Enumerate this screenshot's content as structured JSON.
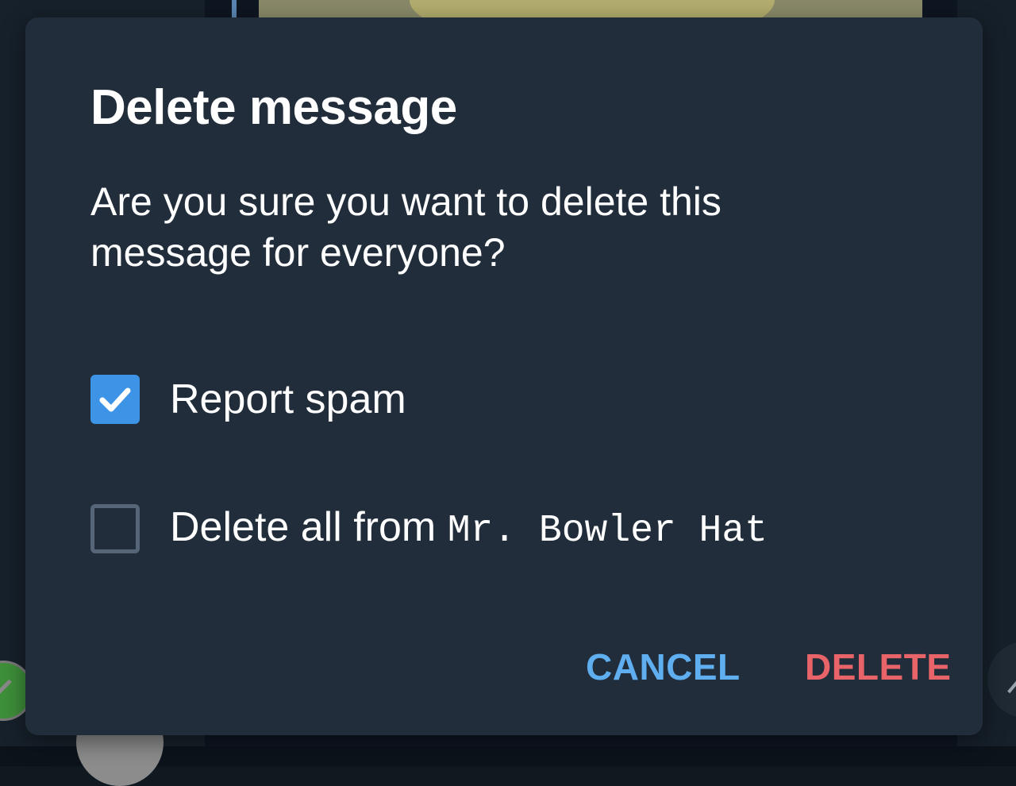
{
  "dialog": {
    "title": "Delete message",
    "body": "Are you sure you want to delete this message for everyone?",
    "options": [
      {
        "label": "Report spam",
        "checked": true
      },
      {
        "label_prefix": "Delete all from ",
        "label_name": "Mr. Bowler Hat",
        "checked": false
      }
    ],
    "cancel_label": "CANCEL",
    "delete_label": "DELETE"
  },
  "colors": {
    "dialog_bg": "#222d3b",
    "accent": "#3d94e6",
    "cancel": "#5eaef0",
    "delete": "#e86469"
  },
  "icons": {
    "checkbox_checked": "checkmark-icon"
  }
}
